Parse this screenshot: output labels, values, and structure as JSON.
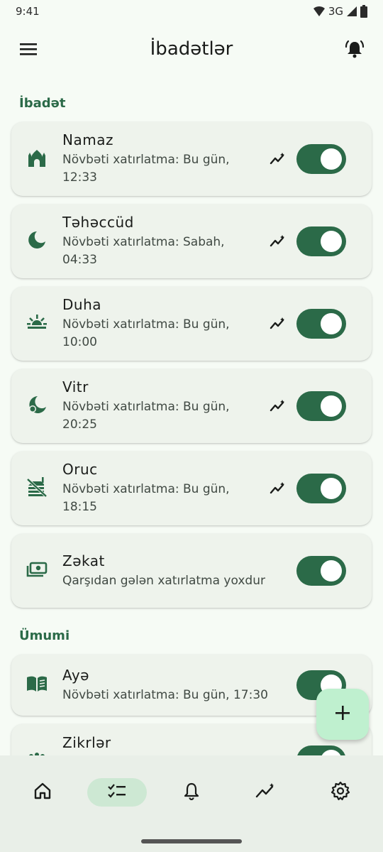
{
  "status": {
    "time": "9:41",
    "network": "3G"
  },
  "appbar": {
    "title": "İbadətlər",
    "menu_icon": "menu-icon",
    "alarm_icon": "alarm-bell-icon"
  },
  "sections": [
    {
      "title": "İbadət",
      "items": [
        {
          "name": "Namaz",
          "sub": "Növbəti xatırlatma: Bu gün, 12:33",
          "icon": "mosque-icon",
          "trend": true,
          "enabled": true
        },
        {
          "name": "Təhəccüd",
          "sub": "Növbəti xatırlatma: Sabah, 04:33",
          "icon": "moon-icon",
          "trend": true,
          "enabled": true
        },
        {
          "name": "Duha",
          "sub": "Növbəti xatırlatma: Bu gün, 10:00",
          "icon": "sunrise-icon",
          "trend": true,
          "enabled": true
        },
        {
          "name": "Vitr",
          "sub": "Növbəti xatırlatma: Bu gün, 20:25",
          "icon": "night-icon",
          "trend": true,
          "enabled": true
        },
        {
          "name": "Oruc",
          "sub": "Növbəti xatırlatma: Bu gün, 18:15",
          "icon": "no-food-icon",
          "trend": true,
          "enabled": true
        },
        {
          "name": "Zəkat",
          "sub": "Qarşıdan gələn xatırlatma yoxdur",
          "icon": "money-icon",
          "trend": false,
          "enabled": true
        }
      ]
    },
    {
      "title": "Ümumi",
      "items": [
        {
          "name": "Ayə",
          "sub": "Növbəti xatırlatma: Bu gün, 17:30",
          "icon": "book-icon",
          "trend": false,
          "enabled": true
        },
        {
          "name": "Zikrlər",
          "sub": "",
          "icon": "beads-icon",
          "trend": false,
          "enabled": true
        }
      ]
    }
  ],
  "fab": {
    "icon": "plus-icon"
  },
  "nav": [
    {
      "icon": "home-icon",
      "active": false
    },
    {
      "icon": "checklist-icon",
      "active": true
    },
    {
      "icon": "bell-icon",
      "active": false
    },
    {
      "icon": "trend-icon",
      "active": false
    },
    {
      "icon": "settings-icon",
      "active": false
    }
  ],
  "colors": {
    "accent": "#2b6a48",
    "fab": "#bff0cf",
    "background": "#f6fbf5",
    "card": "#eef3ec"
  }
}
